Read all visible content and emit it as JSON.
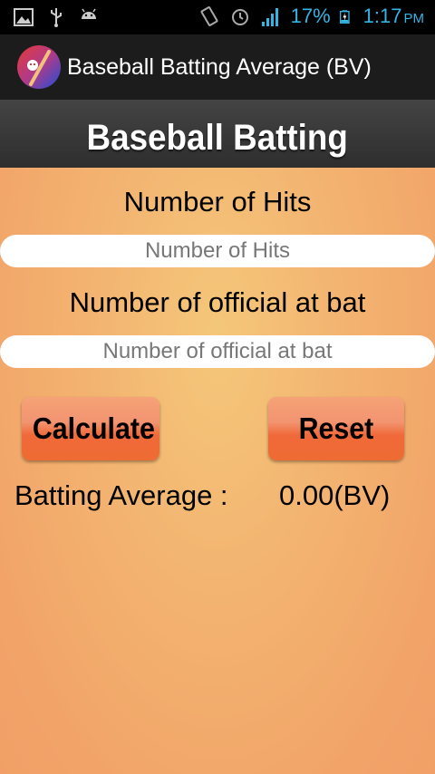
{
  "status_bar": {
    "battery": "17%",
    "time": "1:17",
    "ampm": "PM",
    "icons": [
      "image-icon",
      "usb-icon",
      "android-icon",
      "vibrate-icon",
      "alarm-icon",
      "signal-icon",
      "battery-icon"
    ],
    "text_color": "#33b5e5"
  },
  "action_bar": {
    "title": "Baseball Batting Average (BV)",
    "icon": "baseball-bat-app-icon"
  },
  "header": {
    "title": "Baseball Batting"
  },
  "form": {
    "hits_label": "Number of Hits",
    "hits_placeholder": "Number of Hits",
    "atbat_label": "Number of official at bat",
    "atbat_placeholder": "Number of official at bat"
  },
  "buttons": {
    "calculate": "Calculate",
    "reset": "Reset"
  },
  "result": {
    "label": "Batting Average :",
    "value": "0.00(BV)"
  },
  "colors": {
    "background": "#f3a86b",
    "button": "#f0693a",
    "accent": "#33b5e5"
  }
}
